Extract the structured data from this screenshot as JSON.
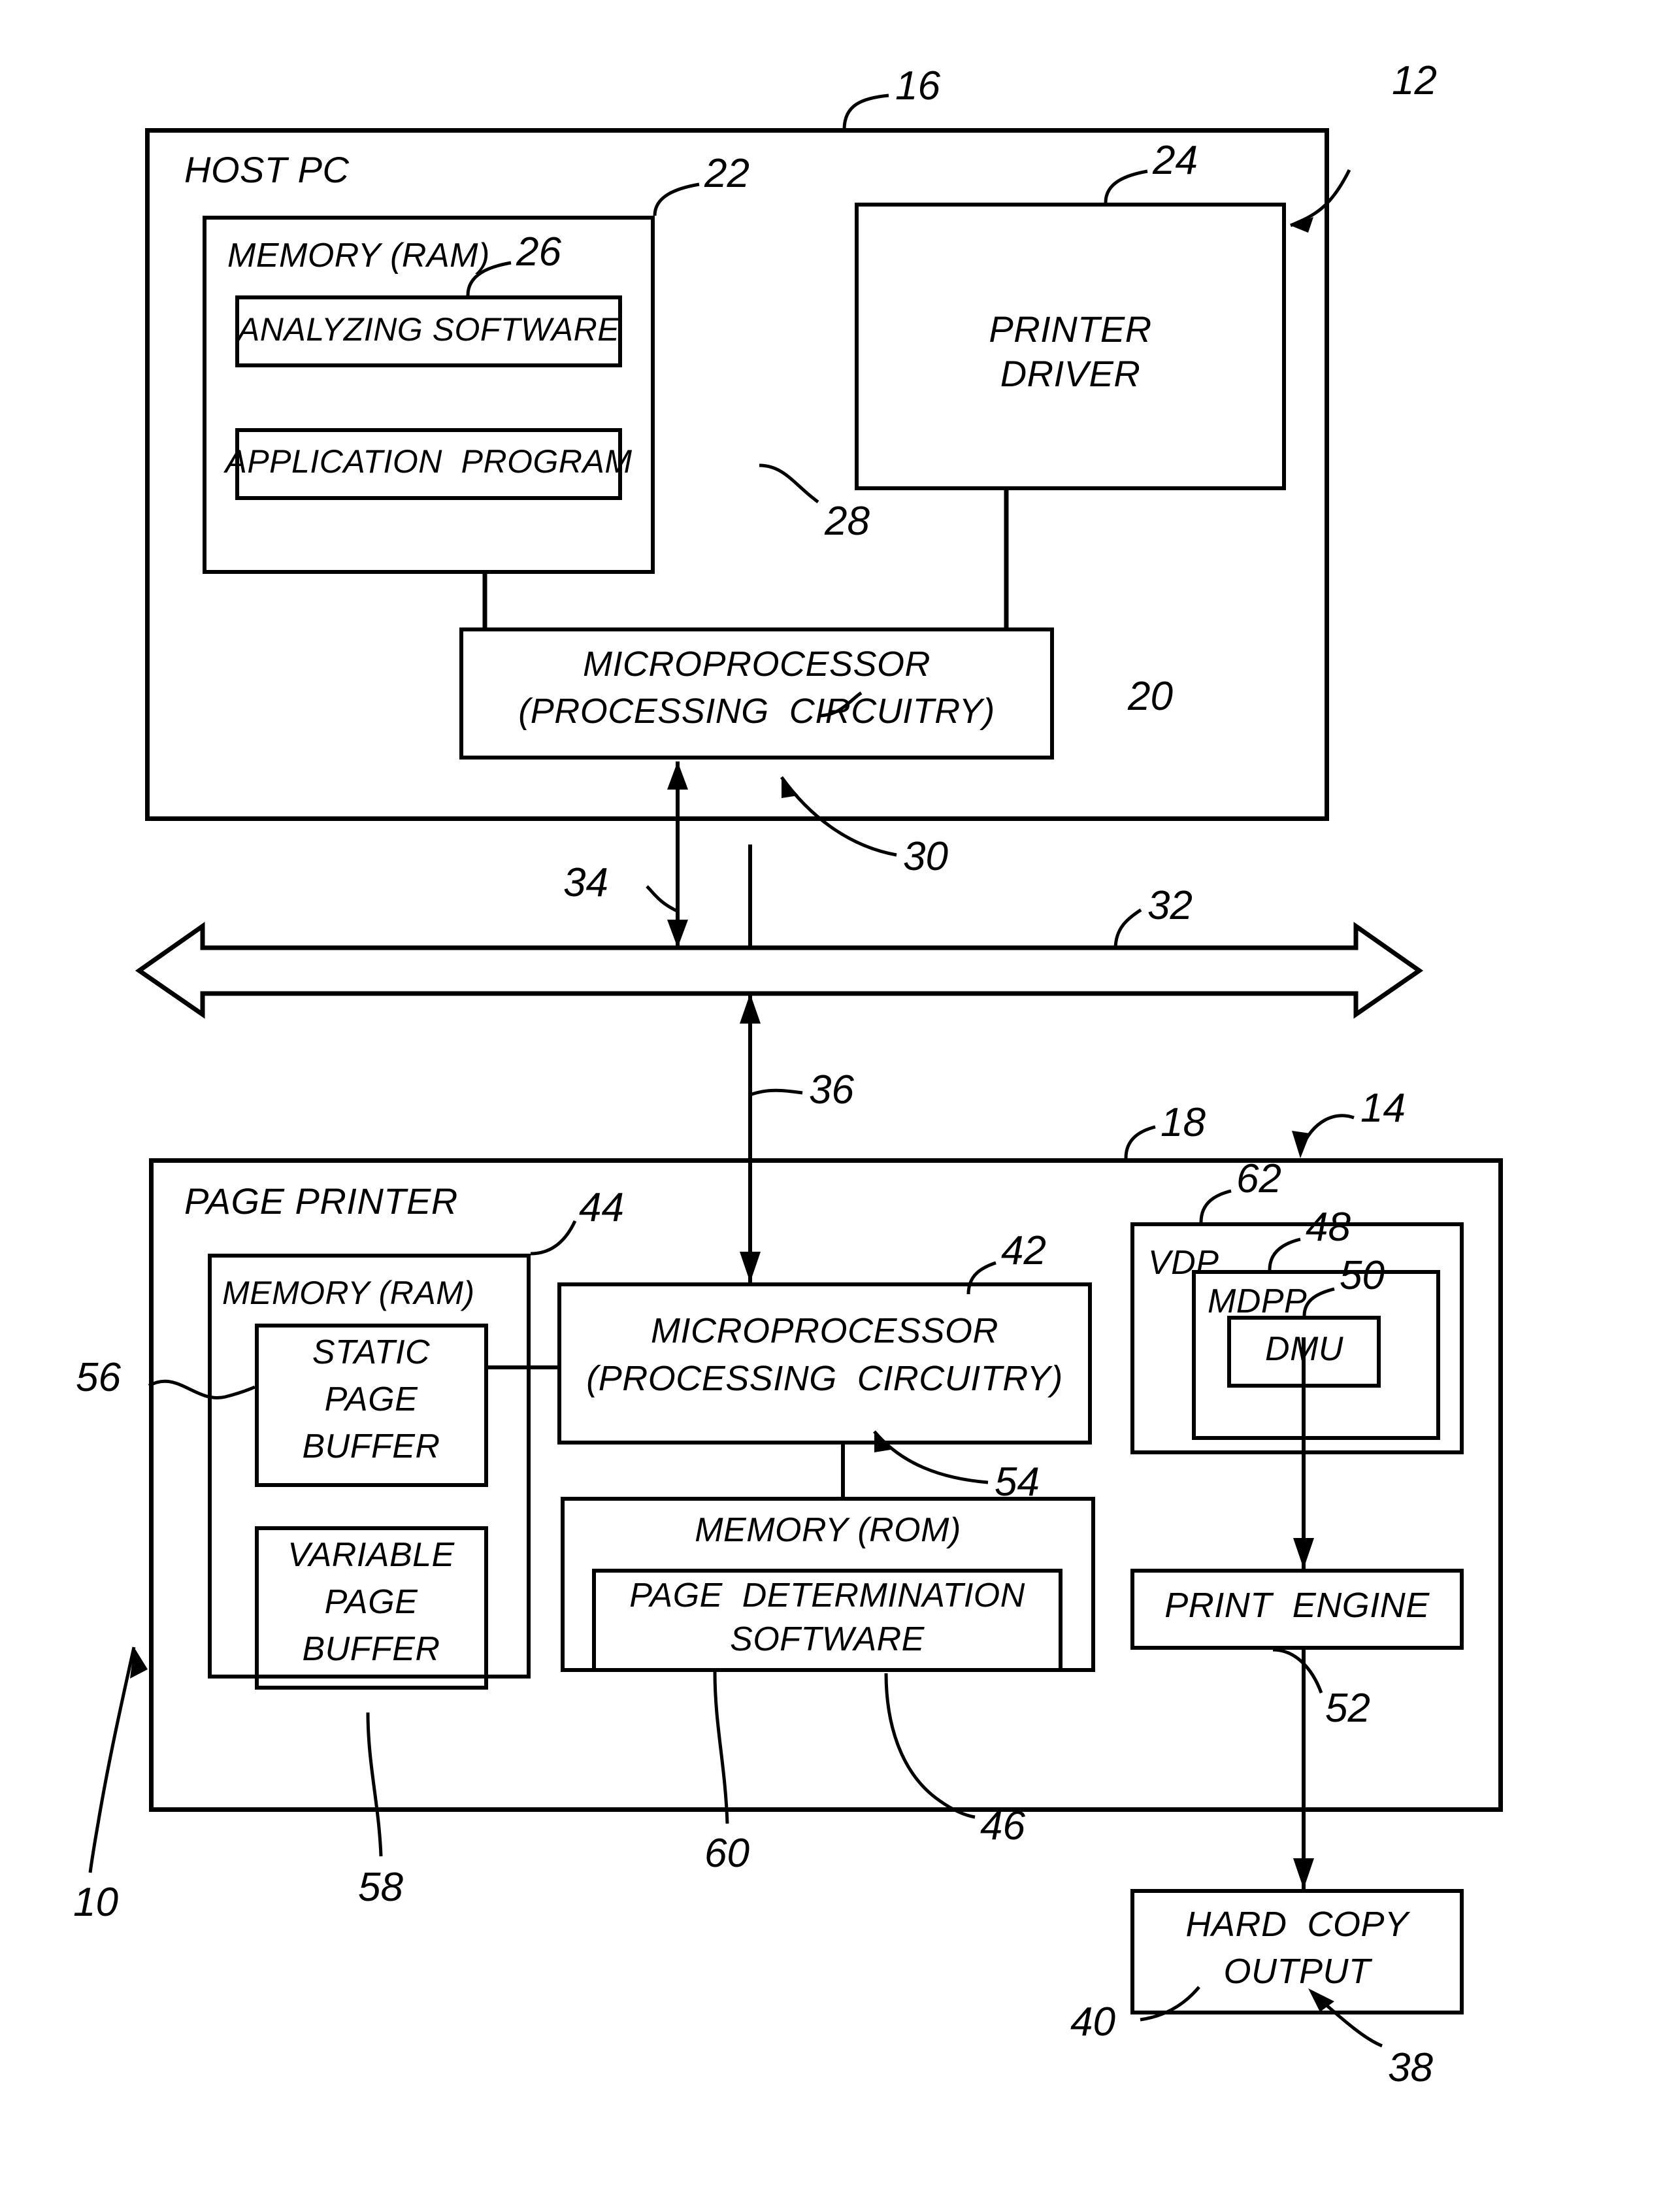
{
  "figure": {
    "type": "patent-block-diagram",
    "title": "",
    "boxes": {
      "host_pc": "HOST PC",
      "host_memory_ram": "MEMORY (RAM)",
      "analyzing_software": "ANALYZING SOFTWARE",
      "application_program": "APPLICATION  PROGRAM",
      "printer_driver_line1": "PRINTER",
      "printer_driver_line2": "DRIVER",
      "host_microprocessor_line1": "MICROPROCESSOR",
      "host_microprocessor_line2": "(PROCESSING  CIRCUITRY)",
      "page_printer": "PAGE PRINTER",
      "printer_memory_ram": "MEMORY (RAM)",
      "static_page_buffer_line1": "STATIC",
      "static_page_buffer_line2": "PAGE",
      "static_page_buffer_line3": "BUFFER",
      "variable_page_buffer_line1": "VARIABLE",
      "variable_page_buffer_line2": "PAGE",
      "variable_page_buffer_line3": "BUFFER",
      "printer_microprocessor_line1": "MICROPROCESSOR",
      "printer_microprocessor_line2": "(PROCESSING  CIRCUITRY)",
      "printer_memory_rom": "MEMORY (ROM)",
      "page_determination_software_line1": "PAGE  DETERMINATION",
      "page_determination_software_line2": "SOFTWARE",
      "vdp": "VDP",
      "mdpp": "MDPP",
      "dmu": "DMU",
      "print_engine": "PRINT  ENGINE",
      "hard_copy_output_line1": "HARD  COPY",
      "hard_copy_output_line2": "OUTPUT"
    },
    "reference_numerals": {
      "n10": "10",
      "n12": "12",
      "n14": "14",
      "n16": "16",
      "n18": "18",
      "n20": "20",
      "n22": "22",
      "n24": "24",
      "n26": "26",
      "n28": "28",
      "n30": "30",
      "n32": "32",
      "n34": "34",
      "n36": "36",
      "n38": "38",
      "n40": "40",
      "n42": "42",
      "n44": "44",
      "n46": "46",
      "n48": "48",
      "n50": "50",
      "n52": "52",
      "n54": "54",
      "n56": "56",
      "n58": "58",
      "n60": "60",
      "n62": "62"
    },
    "colors": {
      "ink": "#000000",
      "paper": "#ffffff"
    }
  }
}
